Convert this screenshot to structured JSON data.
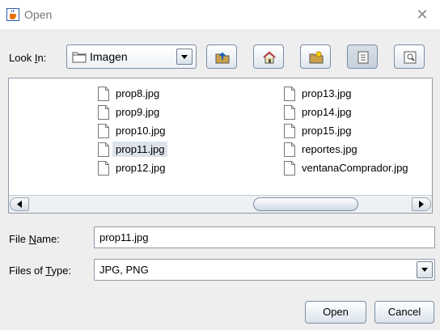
{
  "window": {
    "title": "Open",
    "close_glyph": "✕",
    "icon": "java-cup-icon"
  },
  "lookin": {
    "label_pre": "Look ",
    "label_mnemonic": "I",
    "label_post": "n:",
    "value": "Imagen",
    "icon": "folder-icon"
  },
  "toolbar": {
    "buttons": [
      {
        "name": "up-one-level-button",
        "icon": "folder-up-icon"
      },
      {
        "name": "home-button",
        "icon": "home-icon"
      },
      {
        "name": "new-folder-button",
        "icon": "new-folder-icon"
      },
      {
        "name": "list-view-button",
        "icon": "list-view-icon",
        "pressed": true
      },
      {
        "name": "details-view-button",
        "icon": "details-view-icon"
      }
    ]
  },
  "files": {
    "column1": [
      "prop8.jpg",
      "prop9.jpg",
      "prop10.jpg",
      "prop11.jpg",
      "prop12.jpg"
    ],
    "column2": [
      "prop13.jpg",
      "prop14.jpg",
      "prop15.jpg",
      "reportes.jpg",
      "ventanaComprador.jpg"
    ],
    "selected": "prop11.jpg"
  },
  "filename": {
    "label_pre": "File ",
    "label_mnemonic": "N",
    "label_post": "ame:",
    "value": "prop11.jpg"
  },
  "filetype": {
    "label_pre": "Files of ",
    "label_mnemonic": "T",
    "label_post": "ype:",
    "value": "JPG, PNG"
  },
  "buttons": {
    "open": "Open",
    "cancel": "Cancel"
  },
  "colors": {
    "selection": "#dde3eb",
    "border": "#7a8ea6",
    "folder": "#c9a24a"
  }
}
